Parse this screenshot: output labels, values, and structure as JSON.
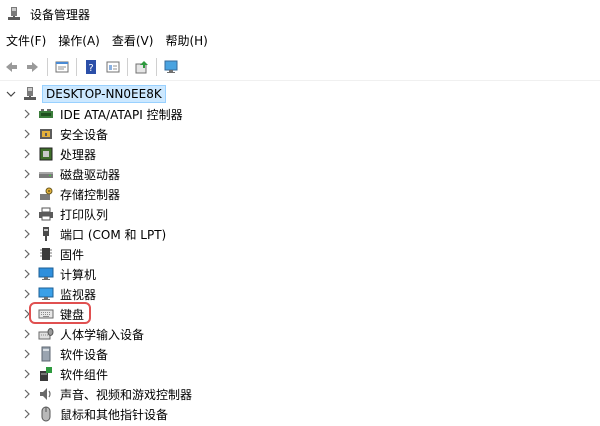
{
  "window": {
    "title": "设备管理器"
  },
  "menu": [
    "文件(F)",
    "操作(A)",
    "查看(V)",
    "帮助(H)"
  ],
  "toolbar": [
    "back-icon",
    "forward-icon",
    "properties-icon",
    "help-icon",
    "view-icon",
    "update-driver-icon",
    "scan-hardware-icon"
  ],
  "tree": {
    "root": "DESKTOP-NN0EE8K",
    "items": [
      {
        "label": "IDE ATA/ATAPI 控制器",
        "icon": "ide-controller-icon"
      },
      {
        "label": "安全设备",
        "icon": "security-device-icon"
      },
      {
        "label": "处理器",
        "icon": "processor-icon"
      },
      {
        "label": "磁盘驱动器",
        "icon": "disk-drive-icon"
      },
      {
        "label": "存储控制器",
        "icon": "storage-controller-icon"
      },
      {
        "label": "打印队列",
        "icon": "printer-icon"
      },
      {
        "label": "端口 (COM 和 LPT)",
        "icon": "port-icon"
      },
      {
        "label": "固件",
        "icon": "firmware-icon"
      },
      {
        "label": "计算机",
        "icon": "computer-icon"
      },
      {
        "label": "监视器",
        "icon": "monitor-icon"
      },
      {
        "label": "键盘",
        "icon": "keyboard-icon"
      },
      {
        "label": "人体学输入设备",
        "icon": "hid-icon"
      },
      {
        "label": "软件设备",
        "icon": "software-device-icon"
      },
      {
        "label": "软件组件",
        "icon": "software-component-icon"
      },
      {
        "label": "声音、视频和游戏控制器",
        "icon": "sound-icon"
      },
      {
        "label": "鼠标和其他指针设备",
        "icon": "mouse-icon"
      }
    ]
  },
  "highlight_color": "#e05050",
  "selection_color": "#cce8ff"
}
